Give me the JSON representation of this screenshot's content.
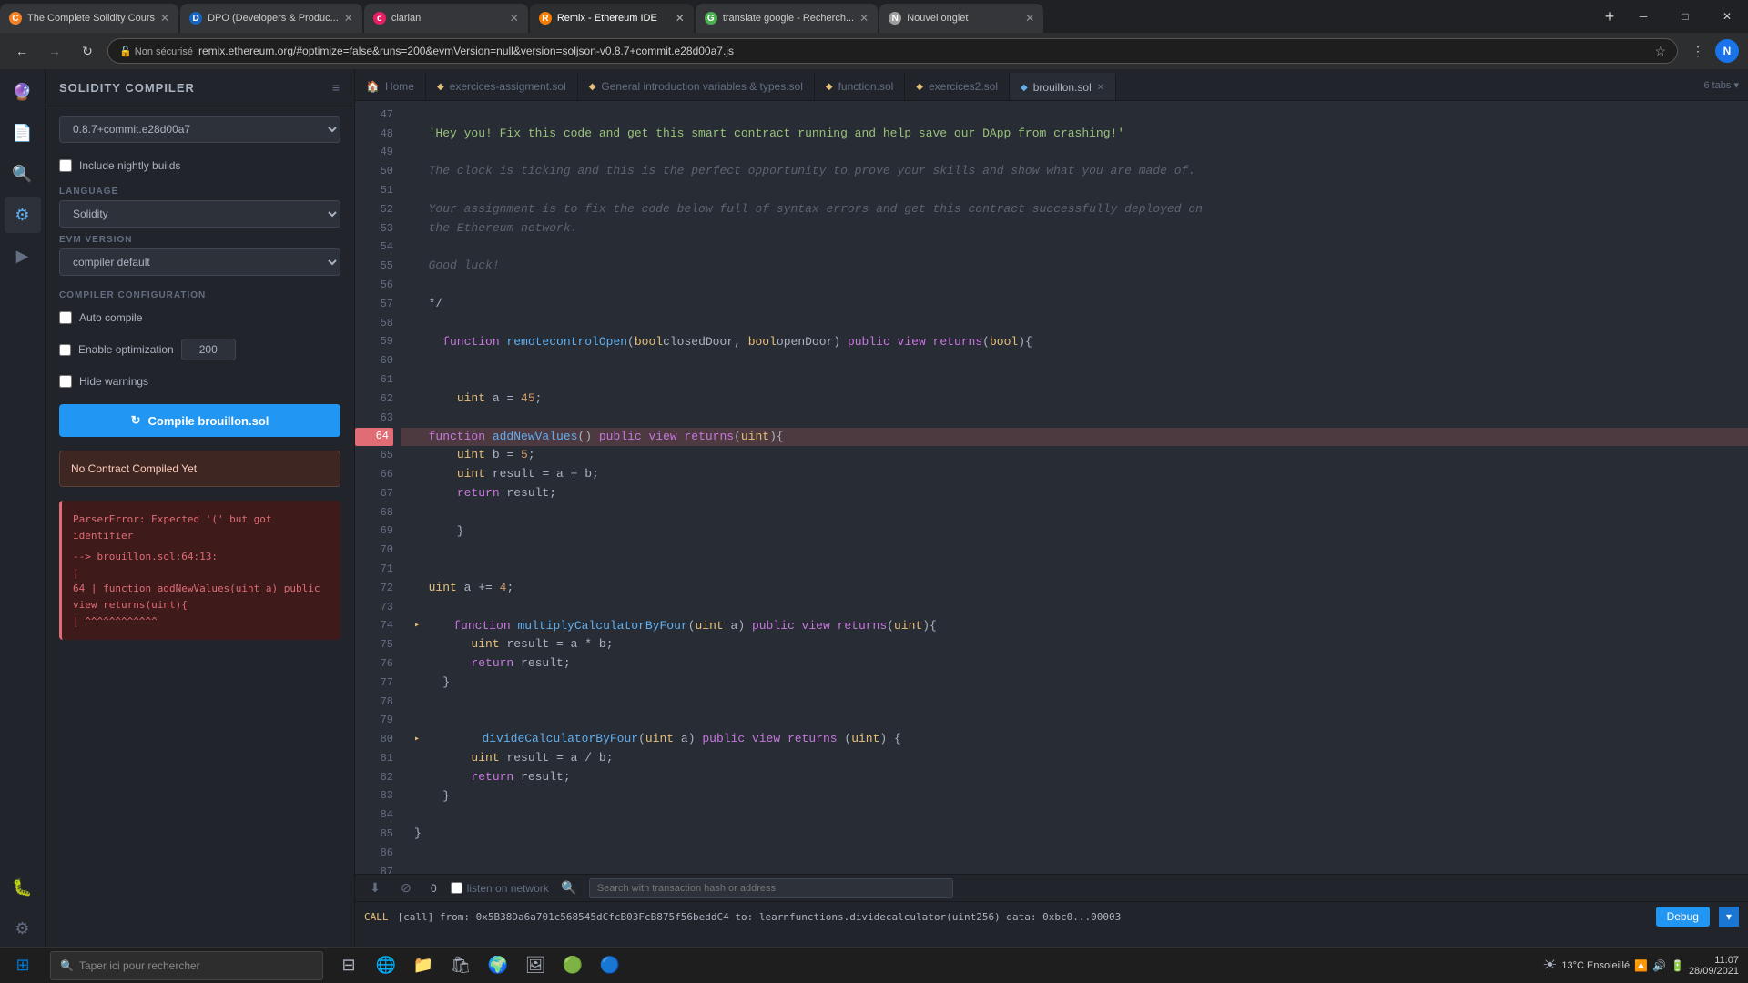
{
  "browser": {
    "tabs": [
      {
        "id": "tab1",
        "favicon_color": "#f48024",
        "favicon_text": "C",
        "title": "The Complete Solidity Cours",
        "active": false,
        "closable": true
      },
      {
        "id": "tab2",
        "favicon_color": "#1565c0",
        "favicon_text": "D",
        "title": "DPO (Developers & Produc...",
        "active": false,
        "closable": true
      },
      {
        "id": "tab3",
        "favicon_color": "#e91e63",
        "favicon_text": "c",
        "title": "clarian",
        "active": false,
        "closable": true
      },
      {
        "id": "tab4",
        "favicon_color": "#f57c00",
        "favicon_text": "R",
        "title": "Remix - Ethereum IDE",
        "active": true,
        "closable": true
      },
      {
        "id": "tab5",
        "favicon_color": "#4caf50",
        "favicon_text": "G",
        "title": "translate google - Recherch...",
        "active": false,
        "closable": true
      },
      {
        "id": "tab6",
        "favicon_color": "#9e9e9e",
        "favicon_text": "N",
        "title": "Nouvel onglet",
        "active": false,
        "closable": true
      }
    ],
    "address": "remix.ethereum.org/#optimize=false&runs=200&evmVersion=null&version=soljson-v0.8.7+commit.e28d00a7.js",
    "address_protocol": "Non sécurisé",
    "tabs_count": "6 tabs ▾"
  },
  "compiler_panel": {
    "title": "SOLIDITY COMPILER",
    "version": "0.8.7+commit.e28d00a7",
    "include_nightly_label": "Include nightly builds",
    "language_label": "LANGUAGE",
    "language_value": "Solidity",
    "evm_label": "EVM VERSION",
    "evm_value": "compiler default",
    "config_label": "COMPILER CONFIGURATION",
    "auto_compile_label": "Auto compile",
    "enable_optimization_label": "Enable optimization",
    "optimization_value": "200",
    "hide_warnings_label": "Hide warnings",
    "compile_btn_label": "Compile brouillon.sol",
    "no_contract_label": "No Contract Compiled Yet",
    "error_text": "ParserError: Expected '(' but got identifier\n\n--> brouillon.sol:64:13:\n |\n64 | function addNewValues(uint a) public view returns(uint){\n | ^^^^^^^^^^^^"
  },
  "editor": {
    "tabs": [
      {
        "label": "Home",
        "icon": "🏠",
        "active": false,
        "closable": false
      },
      {
        "label": "exercices-assigment.sol",
        "icon": "◆",
        "active": false,
        "closable": false
      },
      {
        "label": "General introduction variables & types.sol",
        "icon": "◆",
        "active": false,
        "closable": false
      },
      {
        "label": "function.sol",
        "icon": "◆",
        "active": false,
        "closable": false
      },
      {
        "label": "exercices2.sol",
        "icon": "◆",
        "active": false,
        "closable": false
      },
      {
        "label": "brouillon.sol",
        "icon": "◆",
        "active": true,
        "closable": true
      }
    ],
    "tabs_count": "6 tabs ▾",
    "lines": [
      {
        "num": 47,
        "content": "",
        "type": "blank"
      },
      {
        "num": 48,
        "content": "  'Hey you! Fix this code and get this smart contract running and help save our DApp from crashing!'",
        "type": "string"
      },
      {
        "num": 49,
        "content": "",
        "type": "blank"
      },
      {
        "num": 50,
        "content": "  The clock is ticking and this is the perfect opportunity to prove your skills and show what you are made of.",
        "type": "comment"
      },
      {
        "num": 51,
        "content": "",
        "type": "blank"
      },
      {
        "num": 52,
        "content": "  Your assignment is to fix the code below full of syntax errors and get this contract successfully deployed on",
        "type": "comment"
      },
      {
        "num": 53,
        "content": "  the Ethereum network.",
        "type": "comment"
      },
      {
        "num": 54,
        "content": "",
        "type": "blank"
      },
      {
        "num": 55,
        "content": "  Good luck!",
        "type": "comment"
      },
      {
        "num": 56,
        "content": "",
        "type": "blank"
      },
      {
        "num": 57,
        "content": "  */",
        "type": "code"
      },
      {
        "num": 58,
        "content": "",
        "type": "blank"
      },
      {
        "num": 59,
        "content": "    function remotecontrolOpen(boolclosedDoor, boolopenDoor) public view returns(bool){",
        "type": "code"
      },
      {
        "num": 60,
        "content": "",
        "type": "blank"
      },
      {
        "num": 61,
        "content": "",
        "type": "blank"
      },
      {
        "num": 62,
        "content": "      uint a = 45;",
        "type": "code"
      },
      {
        "num": 63,
        "content": "",
        "type": "blank"
      },
      {
        "num": 64,
        "content": "  function addNewValues() public view returns(uint){",
        "type": "code",
        "error": true
      },
      {
        "num": 65,
        "content": "      uint b = 5;",
        "type": "code"
      },
      {
        "num": 66,
        "content": "      uint result = a + b;",
        "type": "code"
      },
      {
        "num": 67,
        "content": "      return result;",
        "type": "code"
      },
      {
        "num": 68,
        "content": "",
        "type": "blank"
      },
      {
        "num": 69,
        "content": "      }",
        "type": "code"
      },
      {
        "num": 70,
        "content": "",
        "type": "blank"
      },
      {
        "num": 71,
        "content": "",
        "type": "blank"
      },
      {
        "num": 72,
        "content": "  uint a += 4;",
        "type": "code"
      },
      {
        "num": 73,
        "content": "",
        "type": "blank"
      },
      {
        "num": 74,
        "content": "    function multiplyCalculatorByFour(uint a) public view returns(uint){",
        "type": "code"
      },
      {
        "num": 75,
        "content": "        uint result = a * b;",
        "type": "code"
      },
      {
        "num": 76,
        "content": "        return result;",
        "type": "code"
      },
      {
        "num": 77,
        "content": "    }",
        "type": "code"
      },
      {
        "num": 78,
        "content": "",
        "type": "blank"
      },
      {
        "num": 79,
        "content": "",
        "type": "blank"
      },
      {
        "num": 80,
        "content": "        divideCalculatorByFour(uint a) public view returns (uint) {",
        "type": "code"
      },
      {
        "num": 81,
        "content": "        uint result = a / b;",
        "type": "code"
      },
      {
        "num": 82,
        "content": "        return result;",
        "type": "code"
      },
      {
        "num": 83,
        "content": "    }",
        "type": "code"
      },
      {
        "num": 84,
        "content": "",
        "type": "blank"
      },
      {
        "num": 85,
        "content": "}",
        "type": "code"
      },
      {
        "num": 86,
        "content": "",
        "type": "blank"
      },
      {
        "num": 87,
        "content": "",
        "type": "blank"
      }
    ]
  },
  "bottom_panel": {
    "counter": "0",
    "listen_network_label": "listen on network",
    "search_placeholder": "Search with transaction hash or address",
    "call_label": "CALL",
    "call_text": "[call] from: 0x5B38Da6a701c568545dCfcB03FcB875f56beddC4 to: learnfunctions.dividecalculator(uint256) data: 0xbc0...00003",
    "debug_label": "Debug"
  },
  "sidebar": {
    "icons": [
      {
        "name": "remix-logo",
        "symbol": "🔮",
        "active": false
      },
      {
        "name": "file-explorer",
        "symbol": "📁",
        "active": false
      },
      {
        "name": "search",
        "symbol": "🔍",
        "active": false
      },
      {
        "name": "compiler",
        "symbol": "⚙",
        "active": true
      },
      {
        "name": "deploy",
        "symbol": "🚀",
        "active": false
      },
      {
        "name": "debug",
        "symbol": "🐛",
        "active": false
      }
    ],
    "bottom_icon": {
      "name": "settings",
      "symbol": "⚙"
    }
  },
  "taskbar": {
    "search_placeholder": "Taper ici pour rechercher",
    "time": "11:07",
    "date": "28/09/2021",
    "temp": "13°C Ensoleillé"
  }
}
